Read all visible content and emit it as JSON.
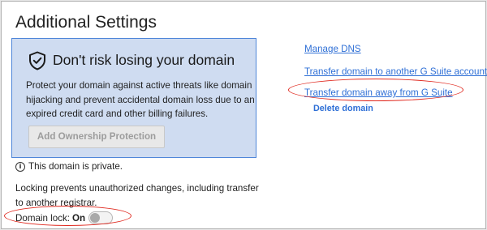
{
  "page": {
    "title": "Additional Settings"
  },
  "promo": {
    "icon": "shield-check-icon",
    "heading": "Don't risk losing your domain",
    "body": "Protect your domain against active threats like domain hijacking and prevent accidental domain loss due to an expired credit card and other billing failures.",
    "button_label": "Add Ownership Protection",
    "accent_color": "#4f86d9",
    "background_color": "#cfdcf1"
  },
  "privacy": {
    "icon": "info-icon",
    "text": "This domain is private."
  },
  "lock": {
    "description": "Locking prevents unauthorized changes, including transfer to another registrar.",
    "label": "Domain lock:",
    "state": "On"
  },
  "links": {
    "manage_dns": "Manage DNS",
    "transfer_to_gsuite": "Transfer domain to another G Suite account",
    "transfer_away": "Transfer domain away from G Suite",
    "delete_domain": "Delete domain",
    "color": "#2e6fd6"
  },
  "annotations": {
    "highlight_color": "#e0291f"
  }
}
